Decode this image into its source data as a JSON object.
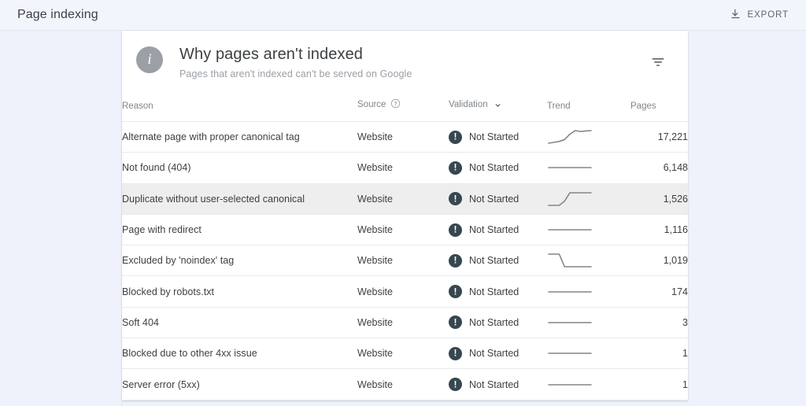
{
  "topbar": {
    "title": "Page indexing",
    "export_label": "EXPORT",
    "export_icon": "download-icon"
  },
  "card": {
    "info_icon": "info-icon",
    "title": "Why pages aren't indexed",
    "subtitle": "Pages that aren't indexed can't be served on Google",
    "filter_icon": "filter-icon"
  },
  "table": {
    "columns": [
      {
        "key": "reason",
        "label": "Reason",
        "icon": null,
        "sorted": false
      },
      {
        "key": "source",
        "label": "Source",
        "icon": "help-circle-icon",
        "sorted": false
      },
      {
        "key": "validation",
        "label": "Validation",
        "icon": "arrow-down-icon",
        "sorted": true
      },
      {
        "key": "trend",
        "label": "Trend",
        "icon": null,
        "sorted": false
      },
      {
        "key": "pages",
        "label": "Pages",
        "icon": null,
        "sorted": false
      }
    ],
    "rows": [
      {
        "reason": "Alternate page with proper canonical tag",
        "source": "Website",
        "validation": "Not Started",
        "status_icon": "exclamation-circle-icon",
        "pages": "17,221",
        "hovered": false,
        "trend": [
          8,
          8.5,
          9,
          10,
          13,
          15,
          14.5,
          14.8,
          15
        ]
      },
      {
        "reason": "Not found (404)",
        "source": "Website",
        "validation": "Not Started",
        "status_icon": "exclamation-circle-icon",
        "pages": "6,148",
        "hovered": false,
        "trend": [
          11,
          11,
          11,
          11,
          11,
          11,
          11,
          11,
          11
        ]
      },
      {
        "reason": "Duplicate without user-selected canonical",
        "source": "Website",
        "validation": "Not Started",
        "status_icon": "exclamation-circle-icon",
        "pages": "1,526",
        "hovered": true,
        "trend": [
          10,
          10,
          10,
          10.5,
          11.5,
          11.5,
          11.5,
          11.5,
          11.5
        ]
      },
      {
        "reason": "Page with redirect",
        "source": "Website",
        "validation": "Not Started",
        "status_icon": "exclamation-circle-icon",
        "pages": "1,116",
        "hovered": false,
        "trend": [
          11,
          11,
          11,
          11,
          11,
          11,
          11,
          11,
          11
        ]
      },
      {
        "reason": "Excluded by 'noindex' tag",
        "source": "Website",
        "validation": "Not Started",
        "status_icon": "exclamation-circle-icon",
        "pages": "1,019",
        "hovered": false,
        "trend": [
          11.5,
          11.5,
          11.5,
          10.5,
          10.5,
          10.5,
          10.5,
          10.5,
          10.5
        ]
      },
      {
        "reason": "Blocked by robots.txt",
        "source": "Website",
        "validation": "Not Started",
        "status_icon": "exclamation-circle-icon",
        "pages": "174",
        "hovered": false,
        "trend": [
          11,
          11,
          11,
          11,
          11,
          11,
          11,
          11,
          11
        ]
      },
      {
        "reason": "Soft 404",
        "source": "Website",
        "validation": "Not Started",
        "status_icon": "exclamation-circle-icon",
        "pages": "3",
        "hovered": false,
        "trend": [
          11,
          11,
          11,
          11,
          11,
          11,
          11,
          11,
          11
        ]
      },
      {
        "reason": "Blocked due to other 4xx issue",
        "source": "Website",
        "validation": "Not Started",
        "status_icon": "exclamation-circle-icon",
        "pages": "1",
        "hovered": false,
        "trend": [
          11,
          11,
          11,
          11,
          11,
          11,
          11,
          11,
          11
        ]
      },
      {
        "reason": "Server error (5xx)",
        "source": "Website",
        "validation": "Not Started",
        "status_icon": "exclamation-circle-icon",
        "pages": "1",
        "hovered": false,
        "trend": [
          11,
          11,
          11,
          11,
          11,
          11,
          11,
          11,
          11
        ]
      }
    ]
  },
  "colors": {
    "page_background": "#eff1fb",
    "card_background": "#ffffff",
    "row_hover": "#eeeeee",
    "status_icon": "#37474f",
    "info_badge": "#9aa0a6",
    "text_primary": "#3c4043",
    "text_secondary": "#80868b",
    "sparkline": "#80868b"
  }
}
